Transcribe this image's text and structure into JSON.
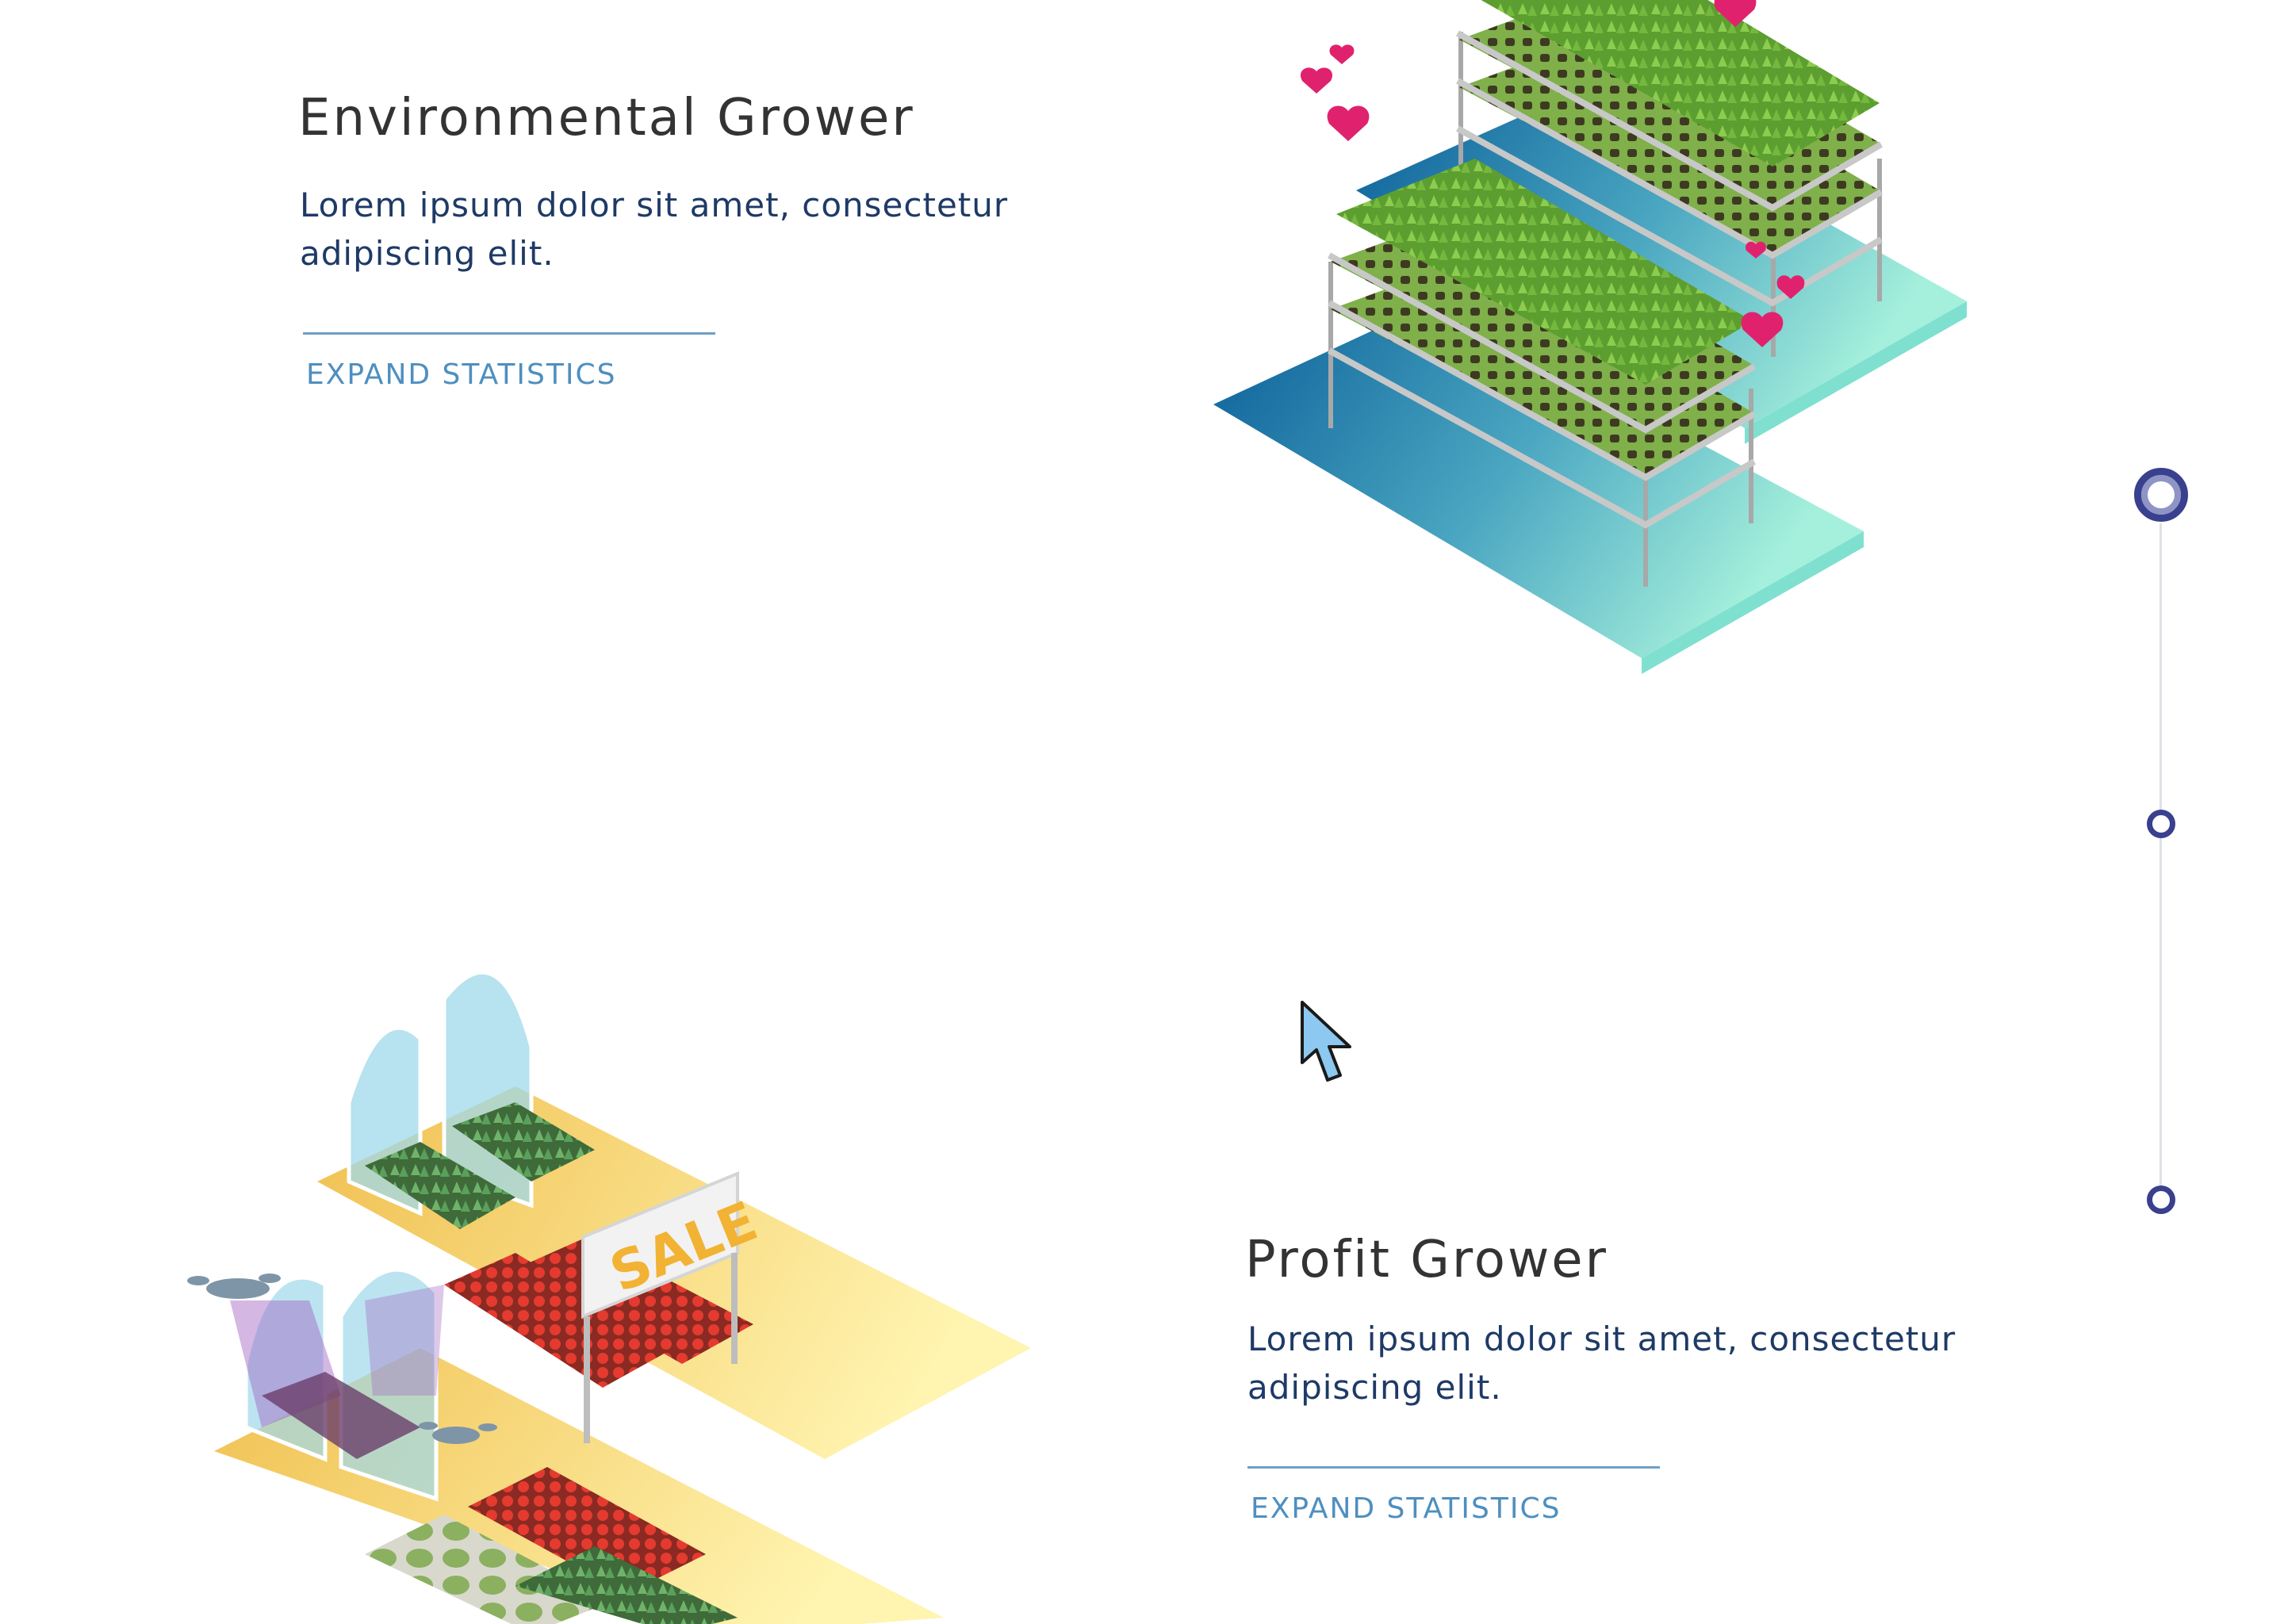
{
  "sections": [
    {
      "title": "Environmental Grower",
      "description": "Lorem ipsum dolor sit amet, consectetur adipiscing elit.",
      "cta": "EXPAND STATISTICS",
      "illustration": "vertical-farm-racks-with-hearts"
    },
    {
      "title": "Profit Grower",
      "description": "Lorem ipsum dolor sit amet, consectetur adipiscing elit.",
      "cta": "EXPAND STATISTICS",
      "illustration": "greenhouse-market-with-sale-sign"
    }
  ],
  "sale_sign": "SALE",
  "timeline": {
    "active_index": 0,
    "count": 3
  },
  "colors": {
    "title": "#333333",
    "description": "#1e3a66",
    "link": "#4e8fc0",
    "timeline": "#39408e",
    "heart": "#e0226e",
    "sale": "#f2b233",
    "plant": "#7dc242",
    "tomato": "#e53a2f"
  }
}
